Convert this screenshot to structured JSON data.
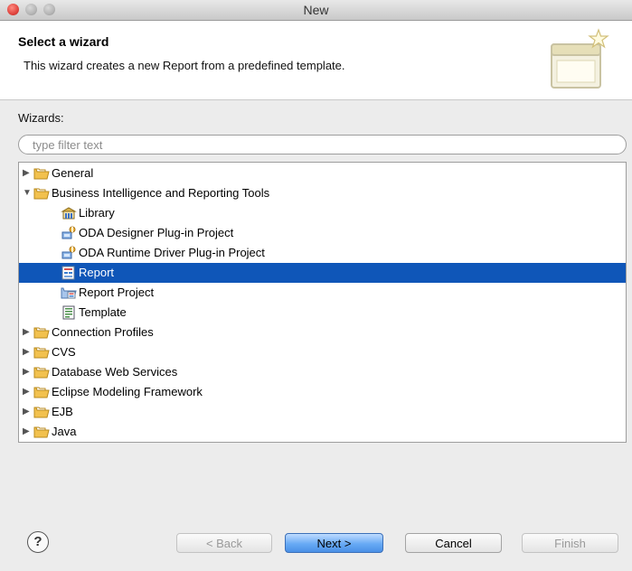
{
  "window": {
    "title": "New"
  },
  "header": {
    "title": "Select a wizard",
    "description": "This wizard creates a new Report from a predefined template."
  },
  "wizards_label": "Wizards:",
  "filter": {
    "placeholder": "type filter text",
    "value": ""
  },
  "tree": [
    {
      "label": "General",
      "icon": "folder-icon",
      "expanded": false,
      "selected": false
    },
    {
      "label": "Business Intelligence and Reporting Tools",
      "icon": "folder-icon",
      "expanded": true,
      "selected": false
    },
    {
      "label": "Library",
      "icon": "library-icon",
      "selected": false
    },
    {
      "label": "ODA Designer Plug-in Project",
      "icon": "plugin-project-icon",
      "selected": false
    },
    {
      "label": "ODA Runtime Driver Plug-in Project",
      "icon": "plugin-project-icon",
      "selected": false
    },
    {
      "label": "Report",
      "icon": "report-icon",
      "selected": true
    },
    {
      "label": "Report Project",
      "icon": "report-project-icon",
      "selected": false
    },
    {
      "label": "Template",
      "icon": "template-icon",
      "selected": false
    },
    {
      "label": "Connection Profiles",
      "icon": "folder-icon",
      "expanded": false,
      "selected": false
    },
    {
      "label": "CVS",
      "icon": "folder-icon",
      "expanded": false,
      "selected": false
    },
    {
      "label": "Database Web Services",
      "icon": "folder-icon",
      "expanded": false,
      "selected": false
    },
    {
      "label": "Eclipse Modeling Framework",
      "icon": "folder-icon",
      "expanded": false,
      "selected": false
    },
    {
      "label": "EJB",
      "icon": "folder-icon",
      "expanded": false,
      "selected": false
    },
    {
      "label": "Java",
      "icon": "folder-icon",
      "expanded": false,
      "selected": false
    }
  ],
  "buttons": {
    "help": "?",
    "back": "< Back",
    "next": "Next >",
    "cancel": "Cancel",
    "finish": "Finish"
  },
  "colors": {
    "selection": "#0f56b8",
    "folder": "#f2c14e"
  }
}
